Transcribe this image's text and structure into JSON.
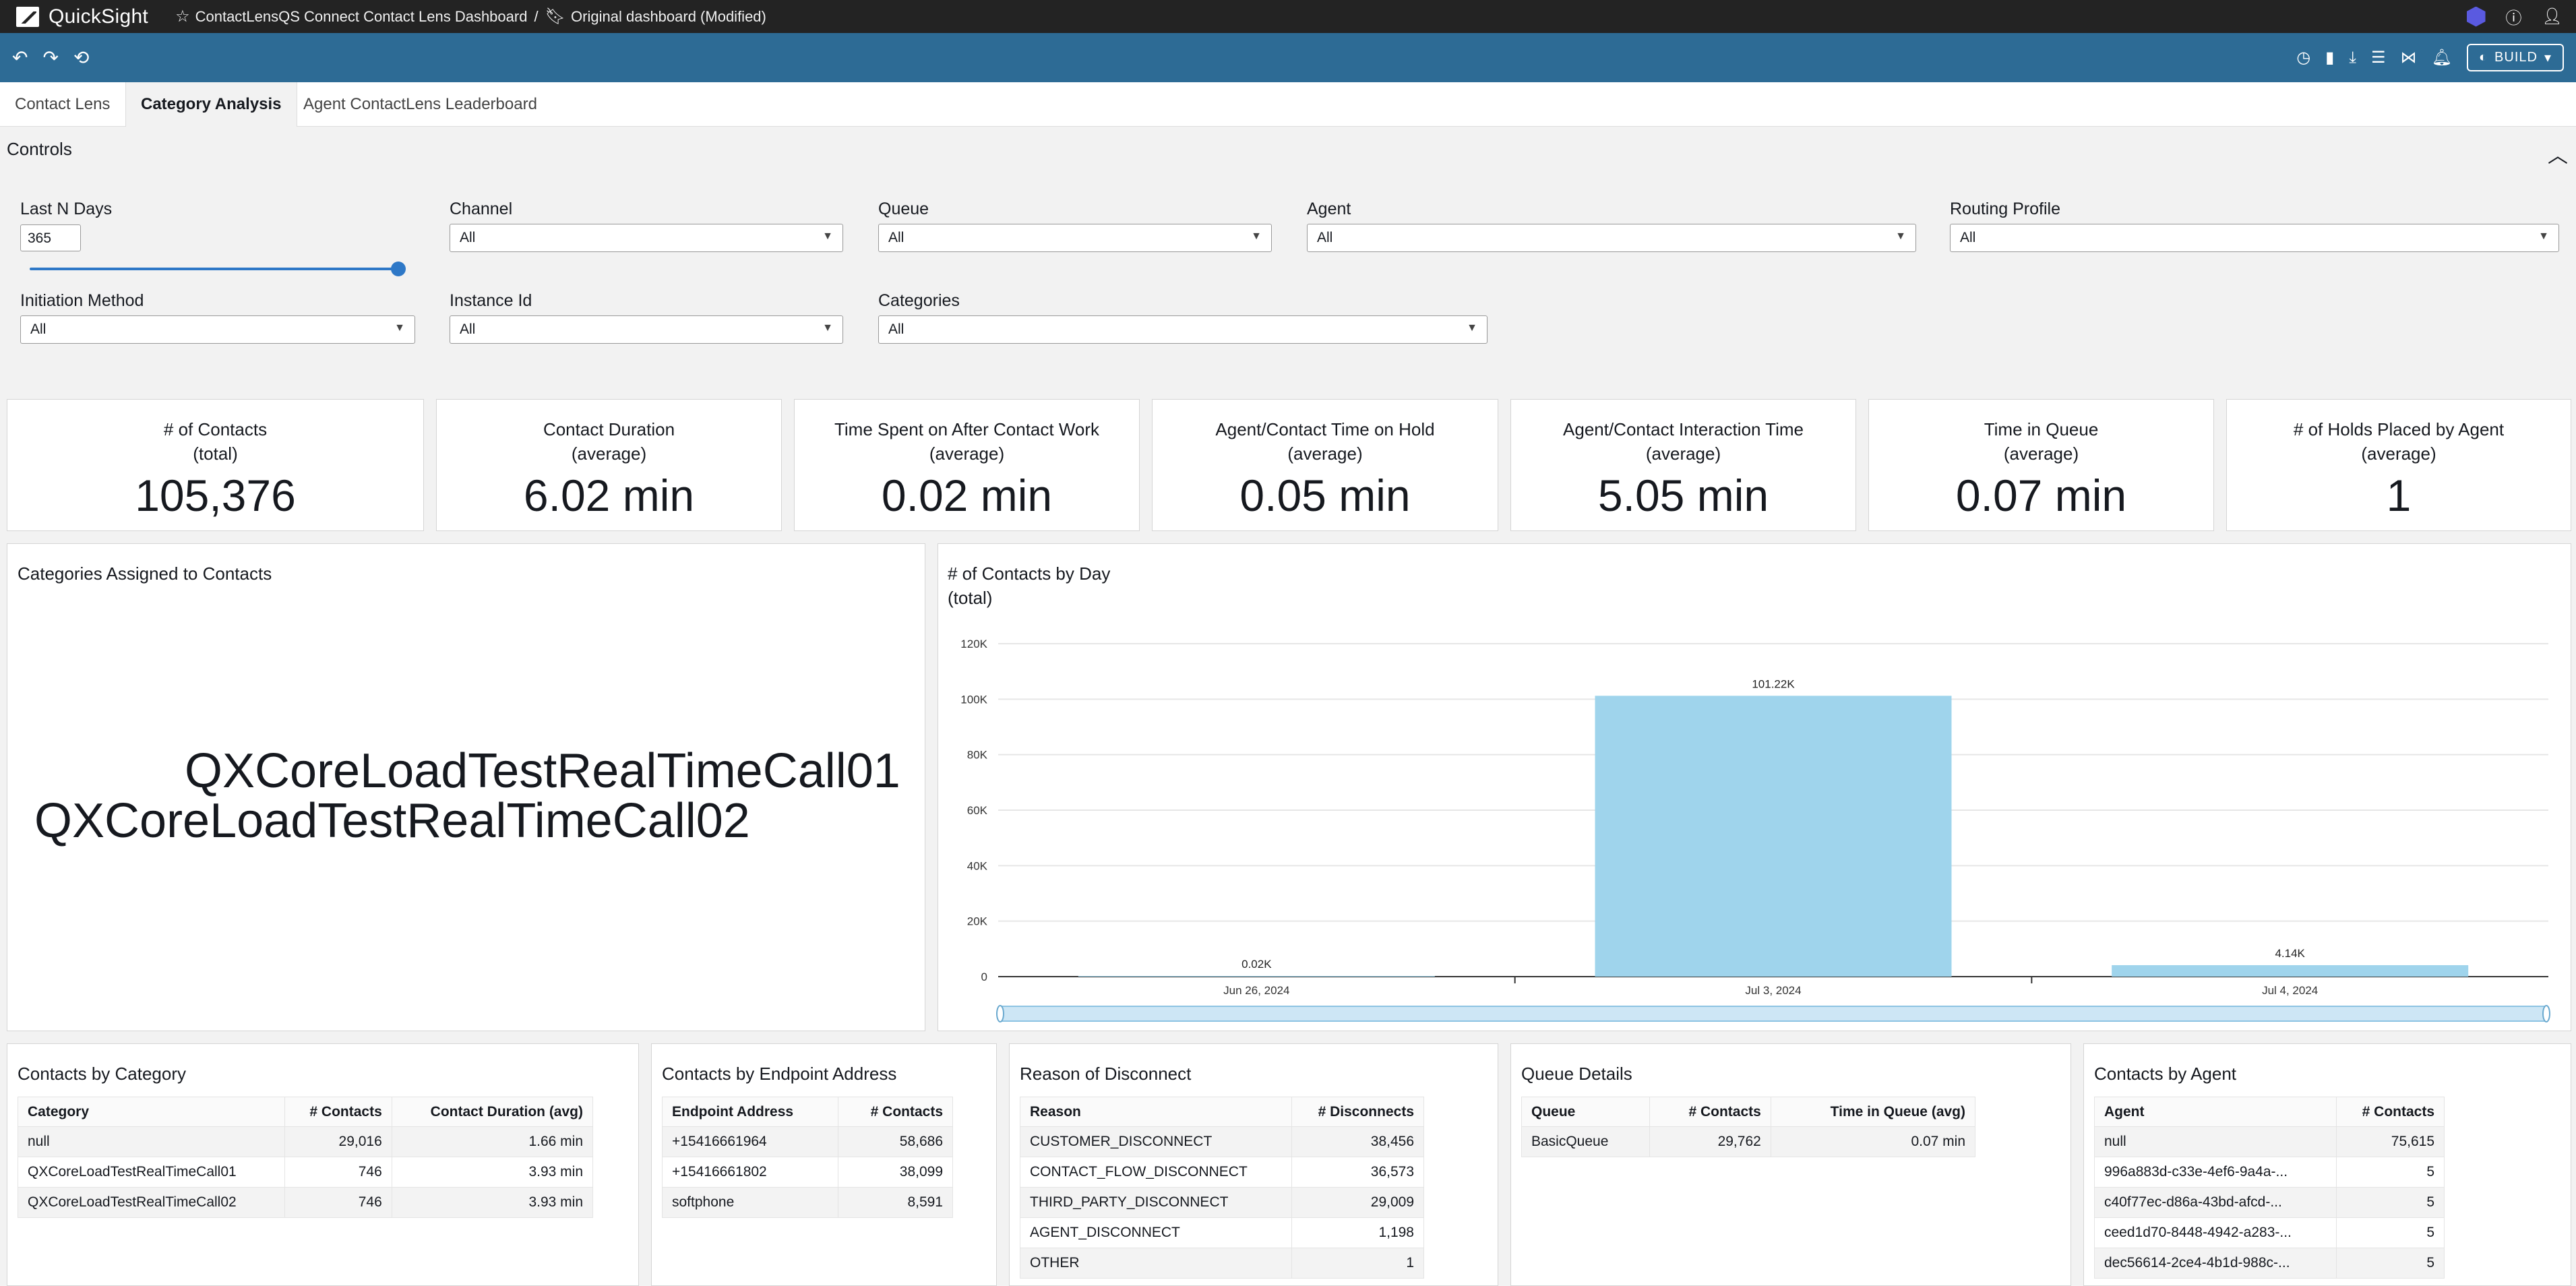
{
  "app": {
    "name": "QuickSight"
  },
  "breadcrumb": {
    "dashboard": "ContactLensQS Connect Contact Lens Dashboard",
    "separator": "/",
    "version": "Original dashboard (Modified)"
  },
  "toolbar": {
    "build_label": "BUILD"
  },
  "tabs": [
    {
      "label": "Contact Lens",
      "active": false
    },
    {
      "label": "Category Analysis",
      "active": true
    },
    {
      "label": "Agent ContactLens Leaderboard",
      "active": false
    }
  ],
  "controls": {
    "title": "Controls",
    "last_n_days": {
      "label": "Last N Days",
      "value": "365"
    },
    "channel": {
      "label": "Channel",
      "value": "All"
    },
    "queue": {
      "label": "Queue",
      "value": "All"
    },
    "agent": {
      "label": "Agent",
      "value": "All"
    },
    "routing_profile": {
      "label": "Routing Profile",
      "value": "All"
    },
    "initiation_method": {
      "label": "Initiation Method",
      "value": "All"
    },
    "instance_id": {
      "label": "Instance Id",
      "value": "All"
    },
    "categories": {
      "label": "Categories",
      "value": "All"
    }
  },
  "kpis": [
    {
      "title": "# of Contacts",
      "sub": "(total)",
      "value": "105,376"
    },
    {
      "title": "Contact Duration",
      "sub": "(average)",
      "value": "6.02 min"
    },
    {
      "title": "Time Spent on After Contact Work",
      "sub": "(average)",
      "value": "0.02 min"
    },
    {
      "title": "Agent/Contact Time on Hold",
      "sub": "(average)",
      "value": "0.05 min"
    },
    {
      "title": "Agent/Contact Interaction Time",
      "sub": "(average)",
      "value": "5.05 min"
    },
    {
      "title": "Time in Queue",
      "sub": "(average)",
      "value": "0.07 min"
    },
    {
      "title": "# of Holds Placed by Agent",
      "sub": "(average)",
      "value": "1"
    }
  ],
  "word_cloud": {
    "title": "Categories Assigned to Contacts",
    "words": [
      "QXCoreLoadTestRealTimeCall01",
      "QXCoreLoadTestRealTimeCall02"
    ]
  },
  "chart_data": {
    "type": "bar",
    "title": "# of Contacts by Day",
    "subtitle": "(total)",
    "categories": [
      "Jun 26, 2024",
      "Jul 3, 2024",
      "Jul 4, 2024"
    ],
    "values": [
      20,
      101220,
      4140
    ],
    "data_labels": [
      "0.02K",
      "101.22K",
      "4.14K"
    ],
    "ylim": [
      0,
      120000
    ],
    "yticks": [
      0,
      20000,
      40000,
      60000,
      80000,
      100000,
      120000
    ],
    "ytick_labels": [
      "0",
      "20K",
      "40K",
      "60K",
      "80K",
      "100K",
      "120K"
    ],
    "grid": true,
    "color": "#9fd4ec"
  },
  "contacts_by_category": {
    "title": "Contacts by Category",
    "headers": [
      "Category",
      "# Contacts",
      "Contact Duration (avg)"
    ],
    "rows": [
      [
        "null",
        "29,016",
        "1.66 min"
      ],
      [
        "QXCoreLoadTestRealTimeCall01",
        "746",
        "3.93 min"
      ],
      [
        "QXCoreLoadTestRealTimeCall02",
        "746",
        "3.93 min"
      ]
    ]
  },
  "contacts_by_endpoint": {
    "title": "Contacts by Endpoint Address",
    "headers": [
      "Endpoint Address",
      "# Contacts"
    ],
    "rows": [
      [
        "+15416661964",
        "58,686"
      ],
      [
        "+15416661802",
        "38,099"
      ],
      [
        "softphone",
        "8,591"
      ]
    ]
  },
  "reason_of_disconnect": {
    "title": "Reason of Disconnect",
    "headers": [
      "Reason",
      "# Disconnects"
    ],
    "rows": [
      [
        "CUSTOMER_DISCONNECT",
        "38,456"
      ],
      [
        "CONTACT_FLOW_DISCONNECT",
        "36,573"
      ],
      [
        "THIRD_PARTY_DISCONNECT",
        "29,009"
      ],
      [
        "AGENT_DISCONNECT",
        "1,198"
      ],
      [
        "OTHER",
        "1"
      ]
    ]
  },
  "queue_details": {
    "title": "Queue Details",
    "headers": [
      "Queue",
      "# Contacts",
      "Time in Queue (avg)"
    ],
    "rows": [
      [
        "BasicQueue",
        "29,762",
        "0.07 min"
      ]
    ]
  },
  "contacts_by_agent": {
    "title": "Contacts by Agent",
    "headers": [
      "Agent",
      "# Contacts"
    ],
    "rows": [
      [
        "null",
        "75,615"
      ],
      [
        "996a883d-c33e-4ef6-9a4a-...",
        "5"
      ],
      [
        "c40f77ec-d86a-43bd-afcd-...",
        "5"
      ],
      [
        "ceed1d70-8448-4942-a283-...",
        "5"
      ],
      [
        "dec56614-2ce4-4b1d-988c-...",
        "5"
      ]
    ]
  }
}
